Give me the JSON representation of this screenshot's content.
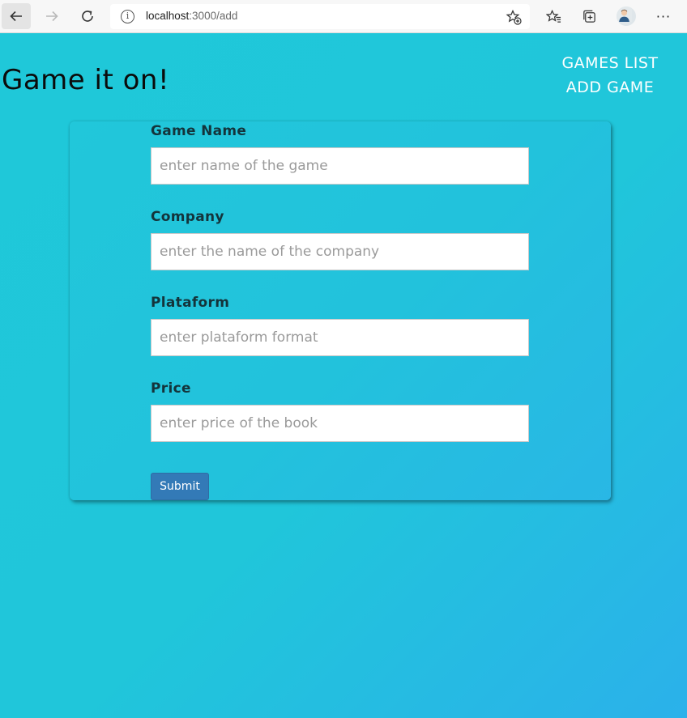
{
  "browser": {
    "url_host": "localhost",
    "url_path": ":3000/add",
    "info_glyph": "i",
    "more_glyph": "···"
  },
  "header": {
    "title": "Game it on!",
    "nav": [
      {
        "label": "GAMES LIST"
      },
      {
        "label": "ADD GAME"
      }
    ]
  },
  "form": {
    "fields": [
      {
        "label": "Game Name",
        "placeholder": "enter name of the game",
        "value": ""
      },
      {
        "label": "Company",
        "placeholder": "enter the name of the company",
        "value": ""
      },
      {
        "label": "Plataform",
        "placeholder": "enter plataform format",
        "value": ""
      },
      {
        "label": "Price",
        "placeholder": "enter price of the book",
        "value": ""
      }
    ],
    "submit_label": "Submit"
  },
  "colors": {
    "page_gradient_start": "#1fc8d9",
    "page_gradient_end": "#2bb1ea",
    "submit_button": "#337ab7",
    "nav_text": "#ffffff"
  },
  "icons": {
    "back": "arrow-left-icon",
    "forward": "arrow-right-icon",
    "reload": "reload-icon",
    "info": "info-icon",
    "add_favorite": "star-plus-icon",
    "favorites": "favorites-icon",
    "collections": "collections-icon",
    "profile": "avatar",
    "more": "more-icon"
  }
}
